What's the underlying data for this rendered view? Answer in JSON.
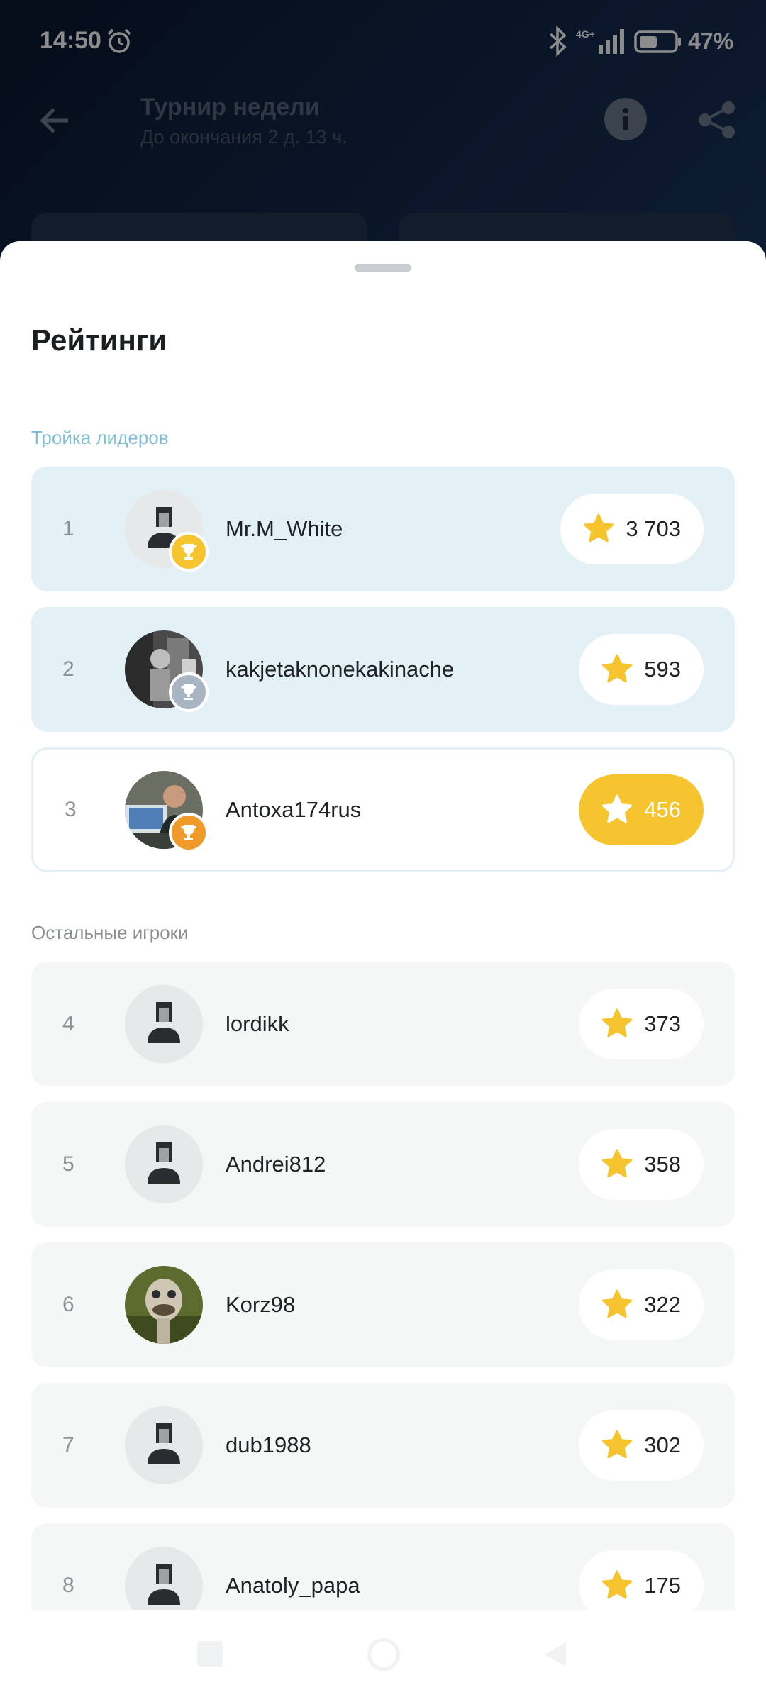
{
  "status_bar": {
    "time": "14:50",
    "network": "4G+",
    "battery_pct": "47%",
    "icons": [
      "alarm-icon",
      "bluetooth-icon",
      "signal-icon",
      "battery-icon"
    ]
  },
  "appbar": {
    "title": "Турнир недели",
    "subtitle": "До окончания 2 д. 13 ч.",
    "icons": [
      "back-arrow-icon",
      "info-icon",
      "share-icon"
    ]
  },
  "sheet": {
    "title": "Рейтинги",
    "leaders_label": "Тройка лидеров",
    "others_label": "Остальные игроки"
  },
  "leaders": [
    {
      "rank": "1",
      "name": "Mr.M_White",
      "score": "3 703",
      "trophy": "gold",
      "avatar": "default"
    },
    {
      "rank": "2",
      "name": "kakjetaknonekakinache",
      "score": "593",
      "trophy": "silver",
      "avatar": "photo"
    },
    {
      "rank": "3",
      "name": "Antoxa174rus",
      "score": "456",
      "trophy": "bronze",
      "avatar": "photo",
      "current_user": true
    }
  ],
  "players": [
    {
      "rank": "4",
      "name": "lordikk",
      "score": "373",
      "avatar": "default"
    },
    {
      "rank": "5",
      "name": "Andrei812",
      "score": "358",
      "avatar": "default"
    },
    {
      "rank": "6",
      "name": "Korz98",
      "score": "322",
      "avatar": "photo"
    },
    {
      "rank": "7",
      "name": "dub1988",
      "score": "302",
      "avatar": "default"
    },
    {
      "rank": "8",
      "name": "Anatoly_papa",
      "score": "175",
      "avatar": "default"
    }
  ],
  "colors": {
    "accent_gold": "#f6c42e",
    "leader_row_bg": "#e3f1f6",
    "leaders_label": "#7fc0d6",
    "row_bg": "#f5f6f6"
  }
}
